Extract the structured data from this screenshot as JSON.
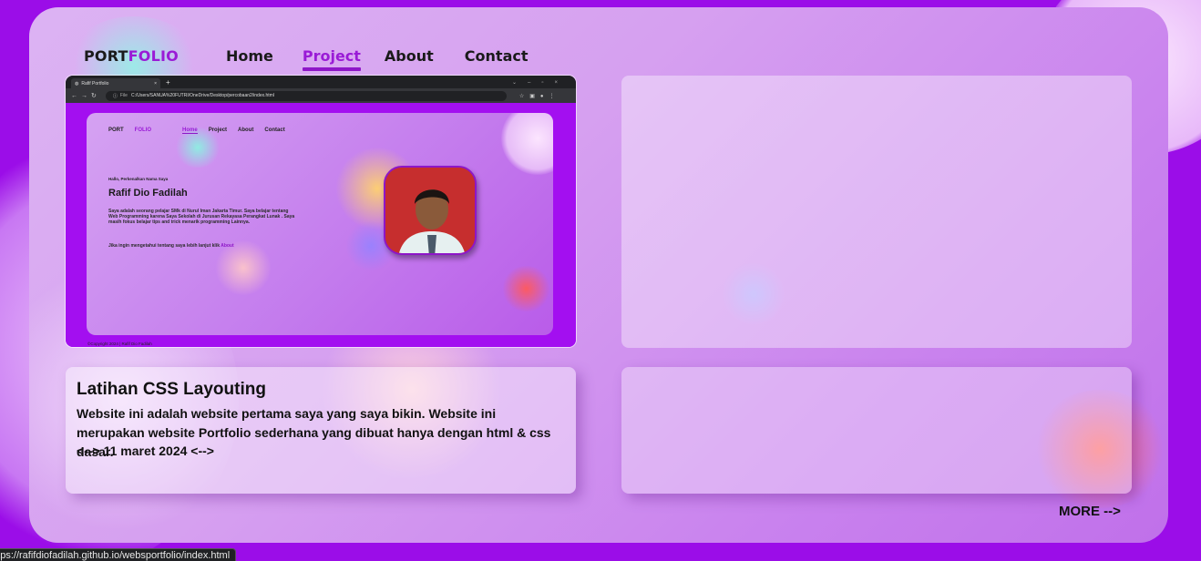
{
  "nav": {
    "logo_main": "PORT",
    "logo_accent": "FOLIO",
    "links": [
      "Home",
      "Project",
      "About",
      "Contact"
    ],
    "active": "Project"
  },
  "project_thumbnail": {
    "browser_tab_title": "Rafif Portfolio",
    "browser_new_tab": "+",
    "address_prefix": "File",
    "address_url": "C:/Users/SANUA%20FUTRI/OneDrive/Desktop/percobaan2/index.html",
    "site": {
      "logo_main": "PORT",
      "logo_accent": "FOLIO",
      "links": [
        "Home",
        "Project",
        "About",
        "Contact"
      ],
      "greeting": "Hallo, Perkenalkan Nama Saya",
      "name": "Rafif Dio Fadilah",
      "description": "Saya adalah seorang pelajar SMk di Nurul Iman Jakarta Timur. Saya belajar tentang Web Programming karena Saya Sekolah di Jurusan Rekayasa Perangkat Lunak . Saya masih fokus belajar tips and trick menarik programming Lainnya.",
      "more_text": "Jika ingin mengetahui tentang saya lebih lanjut klik",
      "more_link": "About",
      "footer": "©Copyright 2024 | Rafif Dio Fadilah"
    }
  },
  "project_card": {
    "title": "Latihan CSS Layouting",
    "description": "Website ini adalah website pertama saya yang saya bikin. Website ini merupakan website Portfolio sederhana yang dibuat hanya dengan html & css dasar.",
    "date": "<--> 11 maret 2024 <-->"
  },
  "more_link": "MORE -->",
  "status_bar_url": "https://rafifdiofadilah.github.io/websportfolio/index.html",
  "colors": {
    "background": "#9b0de8",
    "accent": "#9a1bd6"
  }
}
